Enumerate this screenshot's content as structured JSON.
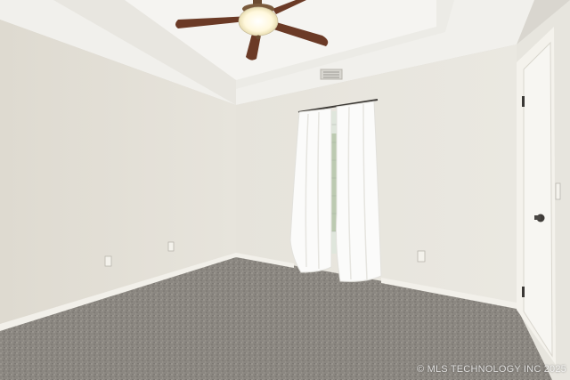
{
  "watermark": "© MLS TECHNOLOGY INC 2025",
  "colors": {
    "wall_left": "#e6e3da",
    "wall_back": "#ebe9e2",
    "wall_right": "#e9e7e0",
    "ceiling": "#f3f2ee",
    "tray": "#f6f5f2",
    "carpet": "#8c8882",
    "trim": "#f3f1ea",
    "fan_blade": "#6b3a26",
    "fan_light": "#fffbe8",
    "curtain": "#fbfbfa"
  }
}
